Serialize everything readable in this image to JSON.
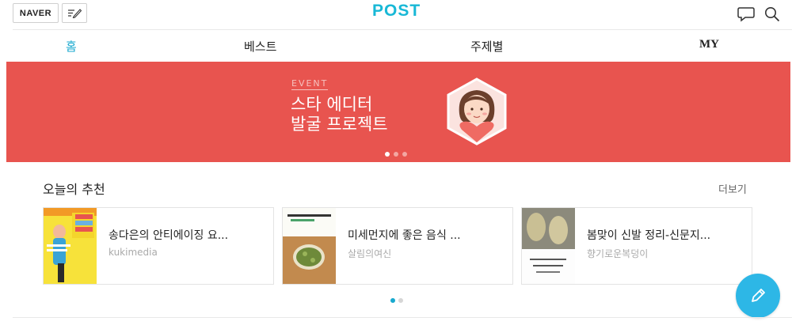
{
  "header": {
    "naver_label": "NAVER",
    "logo": "POST",
    "write_icon": "write-icon",
    "comment_icon": "speech-bubble-icon",
    "search_icon": "search-icon"
  },
  "tabs": [
    {
      "label": "홈",
      "active": true
    },
    {
      "label": "베스트",
      "active": false
    },
    {
      "label": "주제별",
      "active": false
    },
    {
      "label": "MY",
      "active": false
    }
  ],
  "banner": {
    "event_label": "EVENT",
    "line1": "스타 에디터",
    "line2": "발굴 프로젝트",
    "background": "#e8544f",
    "slide_count": 3,
    "active_slide": 1
  },
  "recommend": {
    "title": "오늘의 추천",
    "more": "더보기",
    "cards": [
      {
        "title": "송다은의 안티에이징 요...",
        "author": "kukimedia"
      },
      {
        "title": "미세먼지에 좋은 음식 ...",
        "author": "살림의여신"
      },
      {
        "title": "봄맞이 신발 정리-신문지...",
        "author": "향기로운복덩이"
      }
    ],
    "page_count": 2,
    "active_page": 1
  },
  "fab_icon": "pencil-icon",
  "colors": {
    "accent": "#18b8d6",
    "banner": "#e8544f",
    "fab": "#2db7e6"
  }
}
